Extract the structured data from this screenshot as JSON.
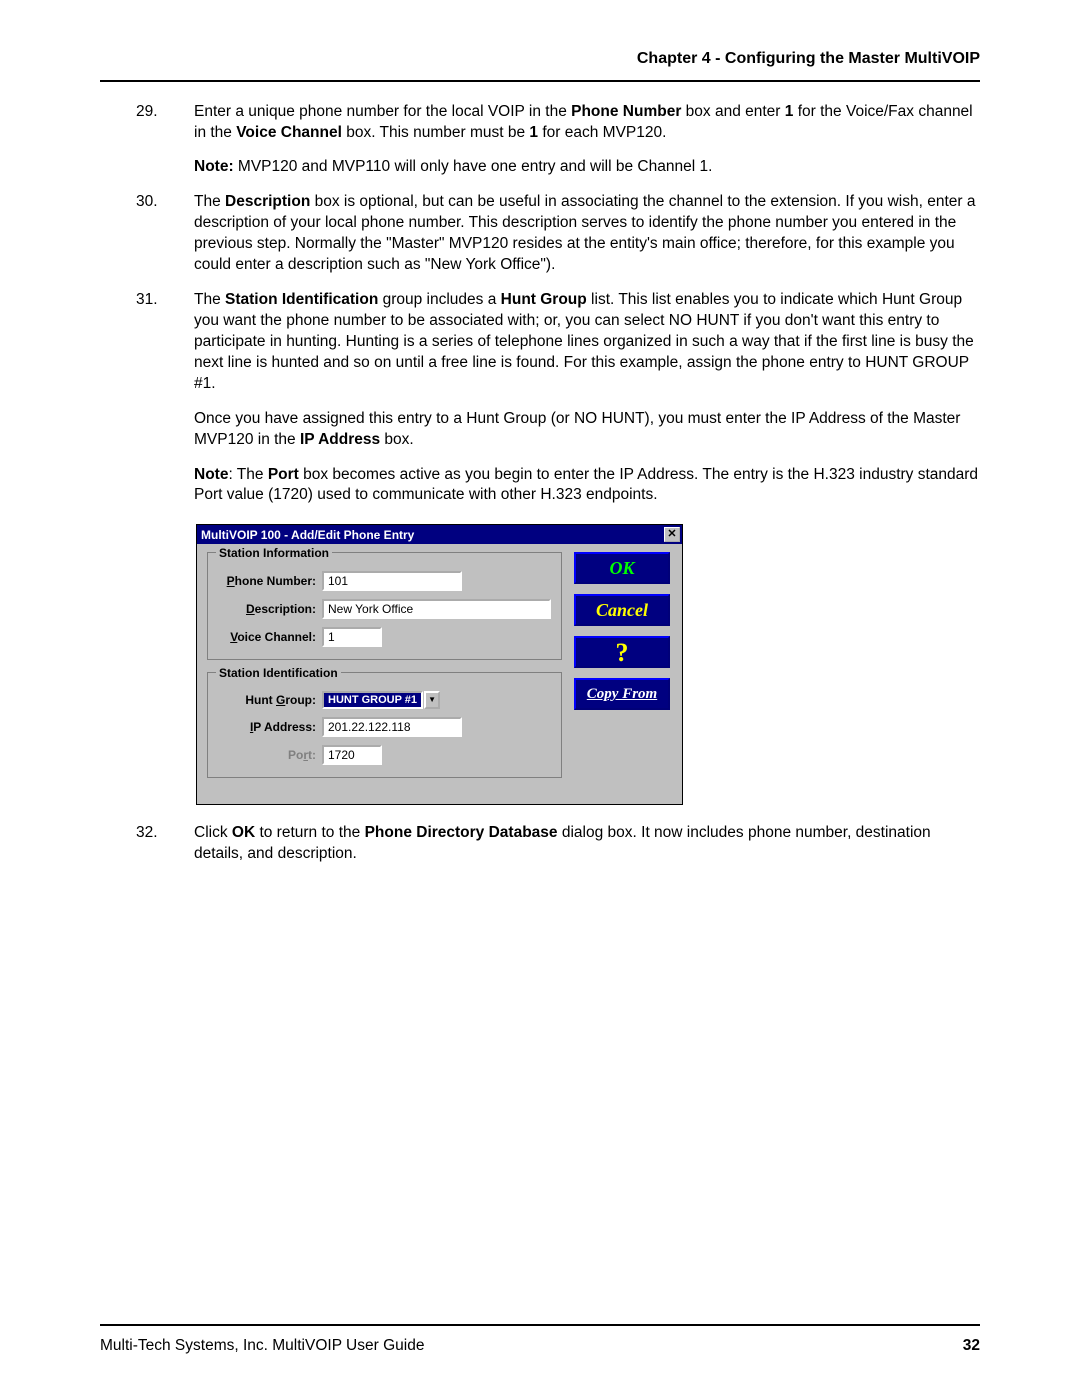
{
  "header": {
    "chapter": "Chapter 4 - Configuring the Master MultiVOIP"
  },
  "steps": {
    "s29": {
      "num": "29.",
      "p1a": "Enter a unique phone number for the local VOIP in the ",
      "p1b": "Phone Number",
      "p1c": " box and enter ",
      "p1d": "1",
      "p1e": " for the Voice/Fax channel in the ",
      "p1f": "Voice Channel",
      "p1g": " box. This number must be ",
      "p1h": "1",
      "p1i": " for each MVP120.",
      "p2a": "Note:",
      "p2b": " MVP120 and MVP110 will only have one entry and will be Channel 1."
    },
    "s30": {
      "num": "30.",
      "p1a": "The ",
      "p1b": "Description",
      "p1c": " box is optional, but can be useful in associating the channel to the extension. If you wish, enter a description of your local phone number. This description serves to identify the phone number you entered in the previous step.  Normally the \"Master\" MVP120 resides at the entity's main office; therefore, for this example you could enter a description such as \"New York Office\")."
    },
    "s31": {
      "num": "31.",
      "p1a": "The ",
      "p1b": "Station Identification",
      "p1c": " group includes a ",
      "p1d": "Hunt Group",
      "p1e": " list. This list enables you to indicate which Hunt Group you want the phone number to be associated with; or, you can select NO HUNT if you don't want this entry to participate in hunting. Hunting is a series of telephone lines organized in such a way that if the first line is busy the next line is hunted and so on until a free line is found. For this example, assign the phone entry to HUNT GROUP #1.",
      "p2a": "Once you have assigned this entry to a Hunt Group (or NO HUNT), you must enter the IP Address of the Master MVP120 in the ",
      "p2b": "IP Address",
      "p2c": " box.",
      "p3a": "Note",
      "p3b": ": The ",
      "p3c": "Port",
      "p3d": " box becomes active as you begin to enter the IP Address. The entry is the H.323 industry standard Port value (1720) used to communicate with other H.323 endpoints."
    },
    "s32": {
      "num": "32.",
      "p1a": "Click ",
      "p1b": "OK",
      "p1c": " to return to the ",
      "p1d": "Phone Directory Database",
      "p1e": " dialog box. It now includes phone number, destination details, and description."
    }
  },
  "dialog": {
    "title": "MultiVOIP 100 - Add/Edit Phone Entry",
    "close": "✕",
    "group1": {
      "legend": "Station Information",
      "phone_label_pre": "P",
      "phone_label_post": "hone Number:",
      "phone_value": "101",
      "desc_label_pre": "D",
      "desc_label_post": "escription:",
      "desc_value": "New York Office",
      "voice_label_pre": "V",
      "voice_label_post": "oice Channel:",
      "voice_value": "1"
    },
    "group2": {
      "legend": "Station Identification",
      "hunt_label_pre": "Hunt ",
      "hunt_label_u": "G",
      "hunt_label_post": "roup:",
      "hunt_value": "HUNT GROUP #1",
      "ip_label_pre": "I",
      "ip_label_post": "P Address:",
      "ip_value": "201.22.122.118",
      "port_label_pre": "Po",
      "port_label_u": "r",
      "port_label_post": "t:",
      "port_value": "1720"
    },
    "buttons": {
      "ok": "OK",
      "cancel": "Cancel",
      "help": "?",
      "copy": "Copy From"
    }
  },
  "footer": {
    "left": "Multi-Tech Systems, Inc. MultiVOIP User Guide",
    "page": "32"
  }
}
